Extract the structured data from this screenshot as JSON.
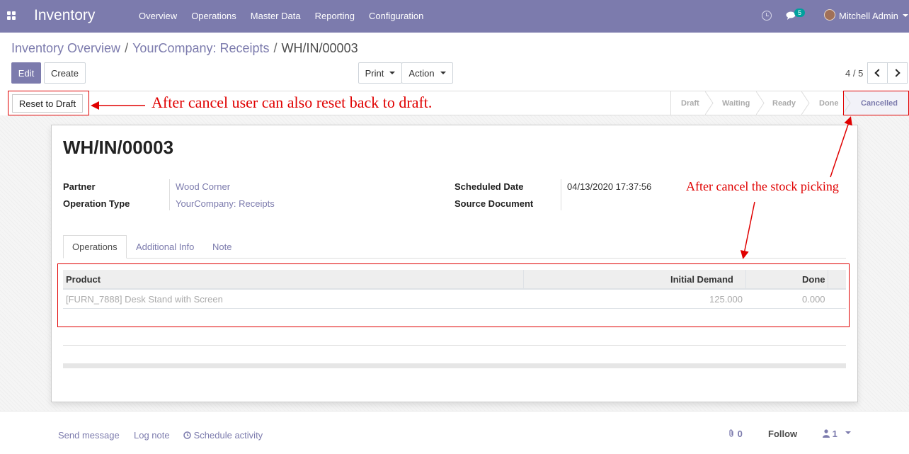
{
  "navbar": {
    "app_title": "Inventory",
    "menu": [
      "Overview",
      "Operations",
      "Master Data",
      "Reporting",
      "Configuration"
    ],
    "chat_count": "5",
    "user_name": "Mitchell Admin"
  },
  "breadcrumb": {
    "items": [
      "Inventory Overview",
      "YourCompany: Receipts"
    ],
    "current": "WH/IN/00003"
  },
  "buttons": {
    "edit": "Edit",
    "create": "Create",
    "print": "Print",
    "action": "Action",
    "reset": "Reset to Draft"
  },
  "pager": {
    "value": "4 / 5"
  },
  "stages": [
    "Draft",
    "Waiting",
    "Ready",
    "Done",
    "Cancelled"
  ],
  "record": {
    "title": "WH/IN/00003",
    "fields": {
      "partner_label": "Partner",
      "partner_value": "Wood Corner",
      "operation_type_label": "Operation Type",
      "operation_type_value": "YourCompany: Receipts",
      "scheduled_date_label": "Scheduled Date",
      "scheduled_date_value": "04/13/2020 17:37:56",
      "source_document_label": "Source Document"
    },
    "tabs": [
      "Operations",
      "Additional Info",
      "Note"
    ],
    "table": {
      "columns": [
        "Product",
        "Initial Demand",
        "Done"
      ],
      "rows": [
        {
          "product": "[FURN_7888] Desk Stand with Screen",
          "initial_demand": "125.000",
          "done": "0.000"
        }
      ]
    }
  },
  "chatter": {
    "send_message": "Send message",
    "log_note": "Log note",
    "schedule_activity": "Schedule activity",
    "attachments": "0",
    "follow": "Follow",
    "followers": "1"
  },
  "annotations": {
    "reset_note": "After cancel user can also reset back to draft.",
    "cancel_note": "After cancel the stock picking"
  },
  "colors": {
    "brand": "#7c7bad",
    "annotation": "#e00000"
  }
}
